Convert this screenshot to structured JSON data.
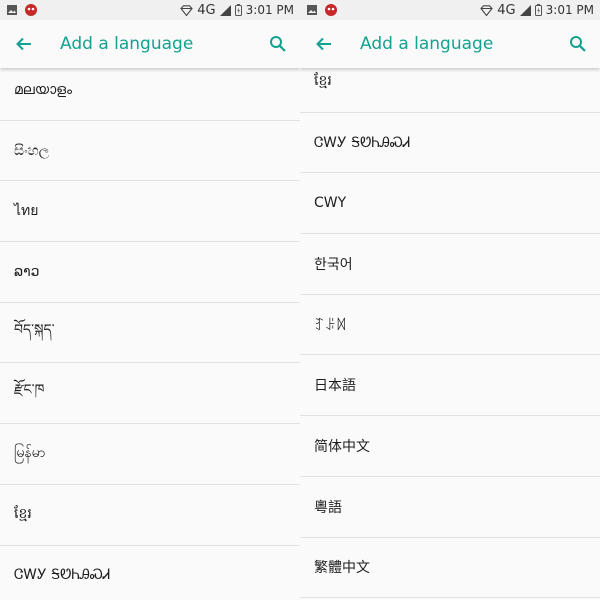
{
  "status": {
    "network": "4G",
    "time": "3:01 PM"
  },
  "appbar": {
    "title": "Add a language"
  },
  "left_list": {
    "items": [
      "മലയാളം",
      "සිංහල",
      "ไทย",
      "ລາວ",
      "བོད་སྐད་",
      "རྫོང་ཁ",
      "မြန်မာ",
      "ខ្មែរ",
      "ᏣᎳᎩ ᎦᏬᏂᎯᏍᏗ"
    ]
  },
  "right_list": {
    "items": [
      "ខ្មែរ",
      "ᏣᎳᎩ ᎦᏬᏂᎯᏍᏗ",
      "CWY",
      "한국어",
      "ꆈꌠꉙ",
      "日本語",
      "简体中文",
      "粵語",
      "繁體中文"
    ]
  },
  "colors": {
    "accent": "#13a190",
    "background": "#fafafa",
    "divider": "#e2e2e2"
  }
}
